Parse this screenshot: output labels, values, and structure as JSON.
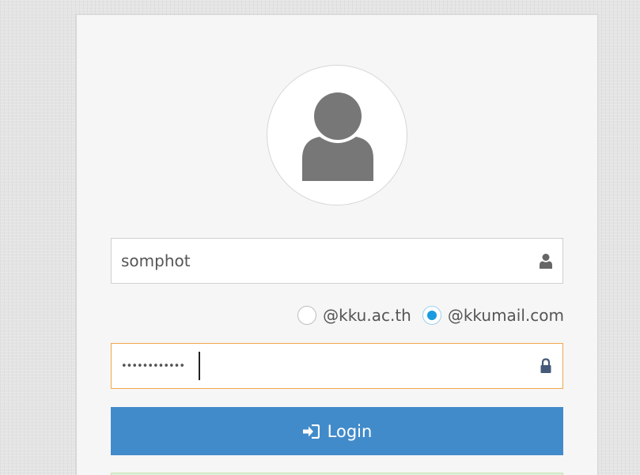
{
  "login": {
    "username_value": "somphot",
    "password_masked": "••••••••••••",
    "domains": [
      {
        "label": "@kku.ac.th",
        "selected": false
      },
      {
        "label": "@kkumail.com",
        "selected": true
      }
    ],
    "login_button_label": "Login"
  },
  "icons": {
    "avatar": "user-silhouette-icon",
    "username_field": "user-icon",
    "password_field": "lock-icon",
    "login_button": "sign-in-icon"
  },
  "colors": {
    "primary_button": "#428bca",
    "focus_border": "#f0a74a",
    "radio_selected": "#1a9be0",
    "success_strip": "#dff0d8"
  }
}
